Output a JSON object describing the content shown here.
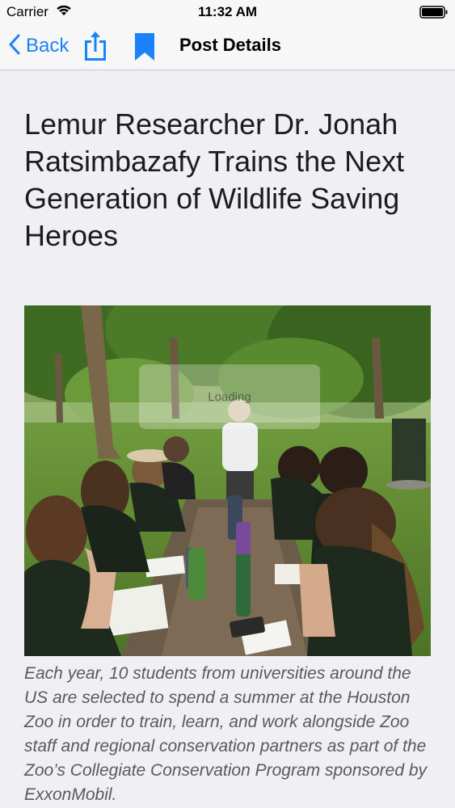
{
  "status_bar": {
    "carrier": "Carrier",
    "time": "11:32 AM"
  },
  "nav": {
    "back_label": "Back",
    "title": "Post Details"
  },
  "post": {
    "title": "Lemur Researcher Dr. Jonah Ratsimbazafy Trains the Next Generation of Wildlife Saving Heroes",
    "image_loading_text": "Loading",
    "caption": "Each year, 10 students from universities around the US are selected to spend a summer at the Houston Zoo in order to train, learn, and work alongside Zoo staff and regional conservation partners as part of the Zoo’s Collegiate Conservation Program sponsored by ExxonMobil."
  },
  "colors": {
    "accent": "#1a82fb",
    "background": "#efeff4"
  }
}
